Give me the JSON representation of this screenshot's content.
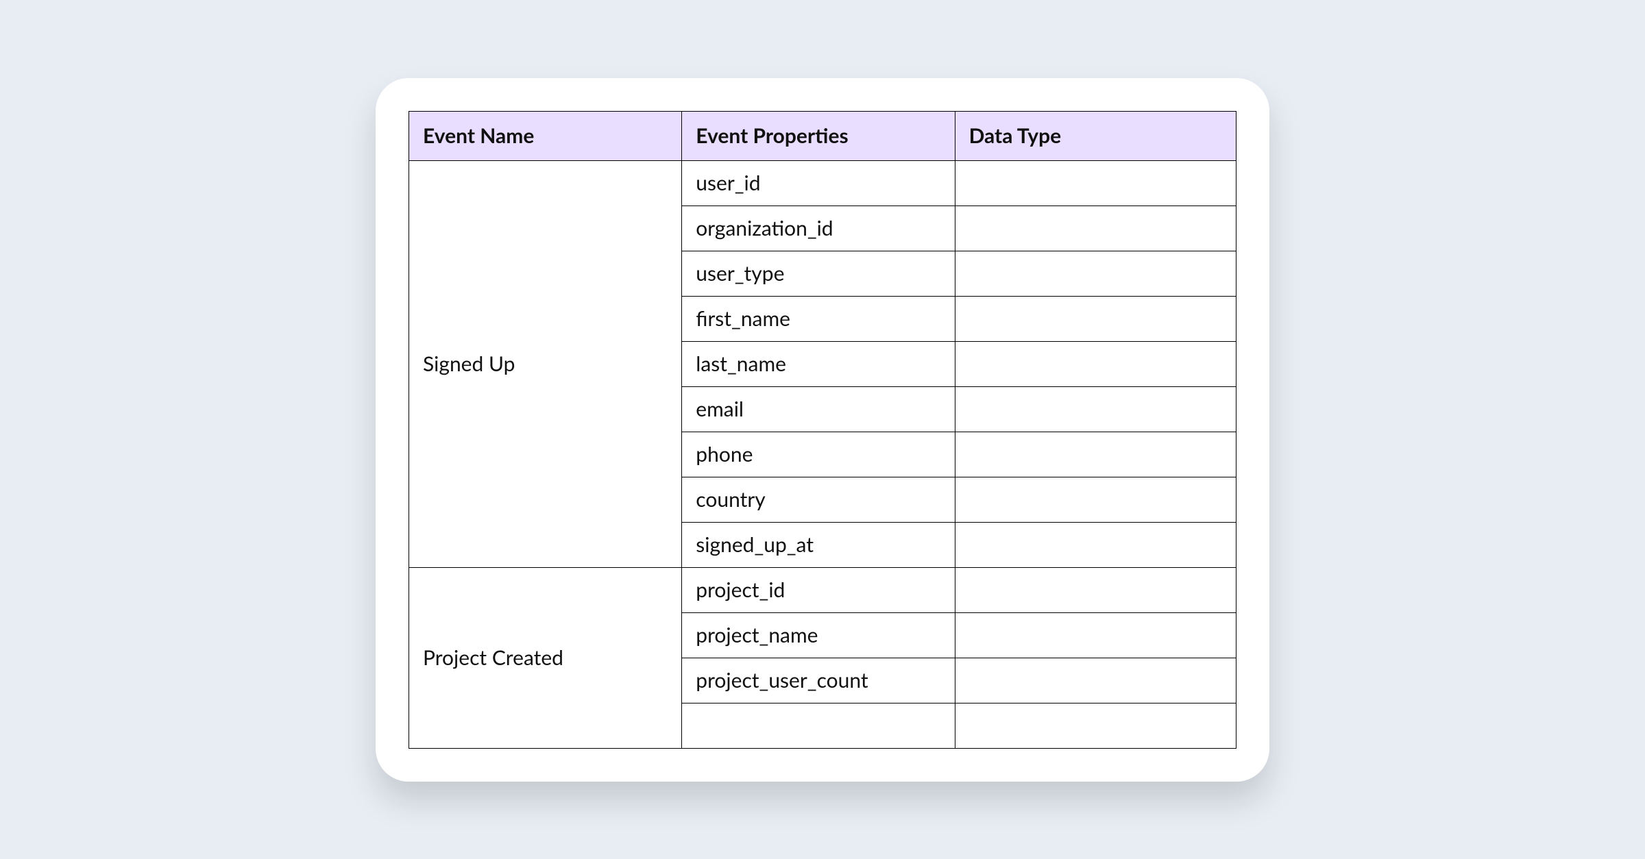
{
  "table": {
    "headers": {
      "col1": "Event Name",
      "col2": "Event Properties",
      "col3": "Data Type"
    },
    "events": [
      {
        "name": "Signed Up",
        "properties": [
          "user_id",
          "organization_id",
          "user_type",
          "first_name",
          "last_name",
          "email",
          "phone",
          "country",
          "signed_up_at"
        ]
      },
      {
        "name": "Project Created",
        "properties": [
          "project_id",
          "project_name",
          "project_user_count",
          ""
        ]
      }
    ]
  }
}
